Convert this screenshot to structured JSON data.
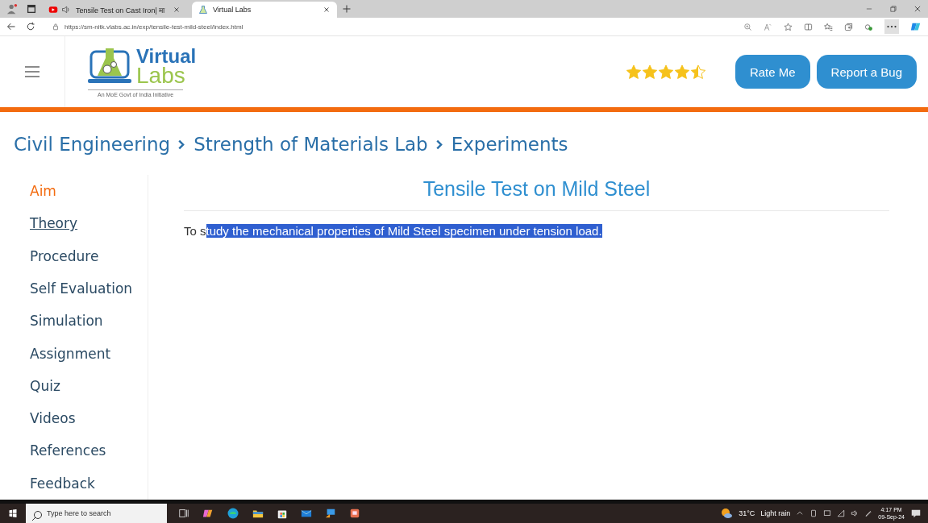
{
  "browser": {
    "tabs": [
      {
        "title": "Tensile Test on Cast Iron| मा",
        "kind": "video",
        "selected": false
      },
      {
        "title": "Virtual Labs",
        "kind": "site",
        "selected": true
      }
    ],
    "address": "https://sm-nitk.vlabs.ac.in/exp/tensile-test-mild-steel/index.html"
  },
  "header": {
    "logo": {
      "word1": "Virtual",
      "word2": "Labs",
      "tagline": "An MoE Govt of India Initiative"
    },
    "stars": 4.5,
    "buttons": [
      "Rate Me",
      "Report a Bug"
    ]
  },
  "breadcrumb": [
    "Civil Engineering",
    "Strength of Materials Lab",
    "Experiments"
  ],
  "sidebar": {
    "items": [
      {
        "label": "Aim",
        "selected": true,
        "hovered": false
      },
      {
        "label": "Theory",
        "selected": false,
        "hovered": true
      },
      {
        "label": "Procedure",
        "selected": false,
        "hovered": false
      },
      {
        "label": "Self Evaluation",
        "selected": false,
        "hovered": false
      },
      {
        "label": "Simulation",
        "selected": false,
        "hovered": false
      },
      {
        "label": "Assignment",
        "selected": false,
        "hovered": false
      },
      {
        "label": "Quiz",
        "selected": false,
        "hovered": false
      },
      {
        "label": "Videos",
        "selected": false,
        "hovered": false
      },
      {
        "label": "References",
        "selected": false,
        "hovered": false
      },
      {
        "label": "Feedback",
        "selected": false,
        "hovered": false
      }
    ]
  },
  "content": {
    "title": "Tensile Test on Mild Steel",
    "paragraph": [
      {
        "text": "To s",
        "highlighted": false
      },
      {
        "text": "tudy the mechanical properties of Mild Steel specimen under tension load.",
        "highlighted": true
      }
    ]
  },
  "taskbar": {
    "search_placeholder": "Type here to search",
    "temperature": "31°C",
    "weather": "Light rain",
    "time": "4:17 PM",
    "date": "09-Sep-24"
  }
}
